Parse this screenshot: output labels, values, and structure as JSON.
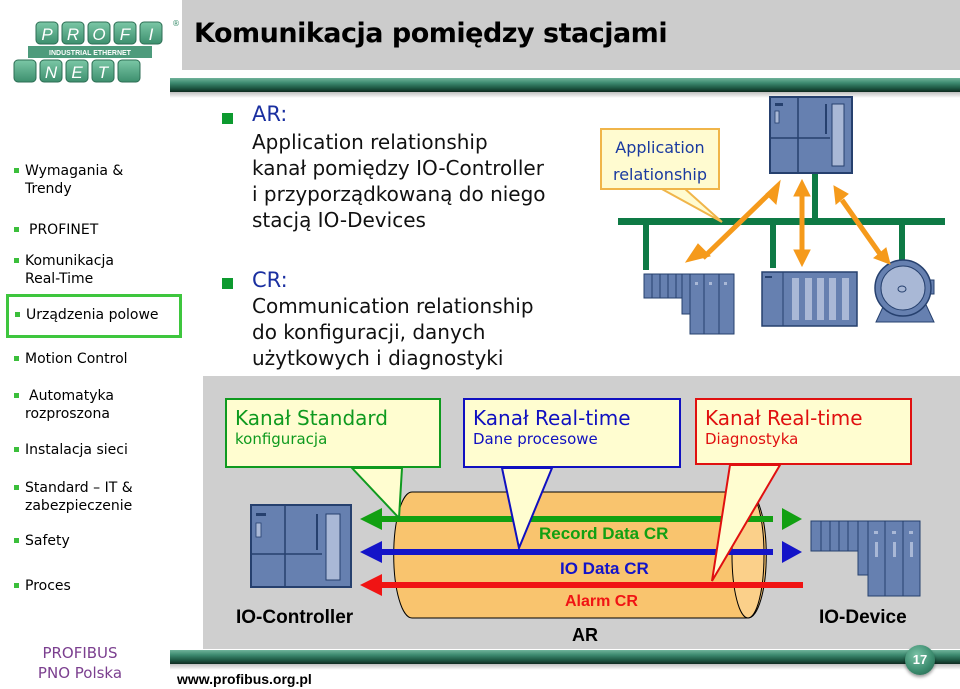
{
  "logo": {
    "top_letters": [
      "P",
      "R",
      "O",
      "F",
      "I"
    ],
    "band_text": "INDUSTRIAL ETHERNET",
    "bottom_letters": [
      "N",
      "E",
      "T"
    ],
    "registered_mark": "®"
  },
  "header": {
    "title": "Komunikacja pomiędzy stacjami"
  },
  "sidebar": {
    "items": [
      {
        "label_lines": [
          "Wymagania &",
          "Trendy"
        ],
        "active": false
      },
      {
        "label_lines": [
          "PROFINET"
        ],
        "active": false
      },
      {
        "label_lines": [
          "Komunikacja",
          "Real-Time"
        ],
        "active": false
      },
      {
        "label_lines": [
          "Urządzenia polowe"
        ],
        "active": true
      },
      {
        "label_lines": [
          "Motion Control"
        ],
        "active": false
      },
      {
        "label_lines": [
          "Automatyka",
          "rozproszona"
        ],
        "active": false
      },
      {
        "label_lines": [
          "Instalacja sieci"
        ],
        "active": false
      },
      {
        "label_lines": [
          "Standard – IT &",
          "zabezpieczenie"
        ],
        "active": false
      },
      {
        "label_lines": [
          "Safety"
        ],
        "active": false
      },
      {
        "label_lines": [
          "Proces"
        ],
        "active": false
      }
    ],
    "org_lines": [
      "PROFIBUS",
      "PNO Polska"
    ]
  },
  "main": {
    "bullets": [
      {
        "heading": "AR:",
        "lines": [
          "Application relationship",
          "kanał pomiędzy IO-Controller",
          "i przyporządkowaną do niego",
          "stacją IO-Devices"
        ]
      },
      {
        "heading": "CR:",
        "lines": [
          "Communication relationship",
          "do konfiguracji, danych",
          "użytkowych i diagnostyki"
        ]
      }
    ]
  },
  "top_diagram": {
    "callout_lines": [
      "Application",
      "relationship"
    ],
    "colors": {
      "bus": "#0e7a45",
      "arrow": "#f59a1b",
      "device_fill": "#6680b0",
      "device_stroke": "#26406e"
    }
  },
  "bottom_diagram": {
    "callouts": [
      {
        "title": "Kanał Standard",
        "subtitle": "konfiguracja",
        "color": "#0f9a1f"
      },
      {
        "title": "Kanał Real-time",
        "subtitle": "Dane procesowe",
        "color": "#1010c0"
      },
      {
        "title": "Kanał Real-time",
        "subtitle": "Diagnostyka",
        "color": "#e01010"
      }
    ],
    "channels": [
      {
        "label": "Record Data CR",
        "color": "#12a012"
      },
      {
        "label": "IO Data CR",
        "color": "#1414c8"
      },
      {
        "label": "Alarm CR",
        "color": "#f01414"
      }
    ],
    "tube_label": "AR",
    "controller_label": "IO-Controller",
    "device_label": "IO-Device",
    "tube_color": "#f9c46e"
  },
  "footer": {
    "url": "www.profibus.org.pl",
    "page_number": "17"
  }
}
